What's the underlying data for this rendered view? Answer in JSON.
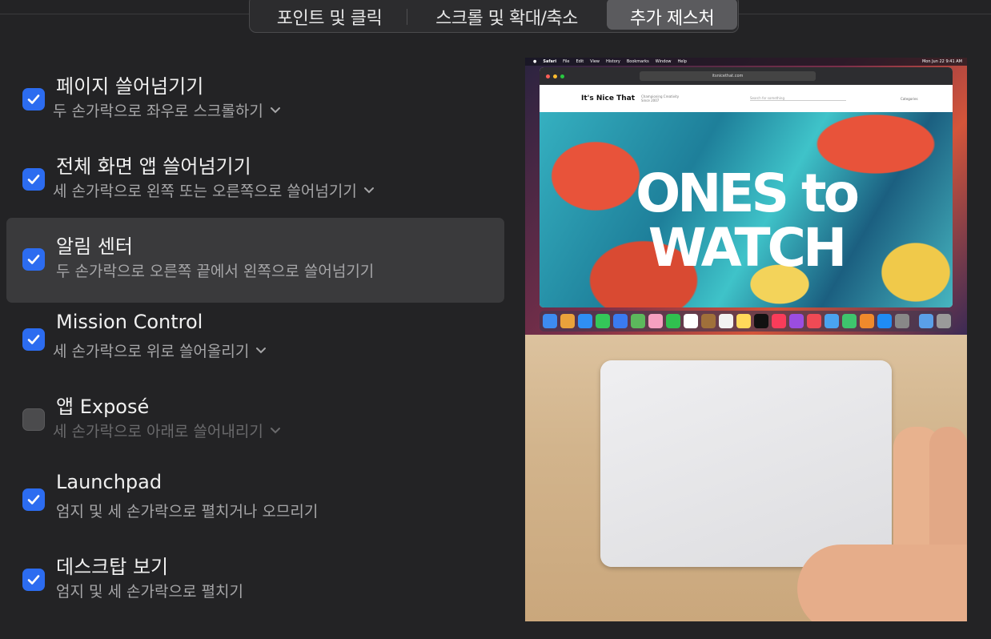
{
  "tabs": [
    {
      "label": "포인트 및 클릭",
      "active": false
    },
    {
      "label": "스크롤 및 확대/축소",
      "active": false
    },
    {
      "label": "추가 제스처",
      "active": true
    }
  ],
  "gestures": [
    {
      "title": "페이지 쓸어넘기기",
      "subtitle": "두 손가락으로 좌우로 스크롤하기",
      "checked": true,
      "has_dropdown": true
    },
    {
      "title": "전체 화면 앱 쓸어넘기기",
      "subtitle": "세 손가락으로 왼쪽 또는 오른쪽으로 쓸어넘기기",
      "checked": true,
      "has_dropdown": true
    },
    {
      "title": "알림 센터",
      "subtitle": "두 손가락으로 오른쪽 끝에서 왼쪽으로 쓸어넘기기",
      "checked": true,
      "has_dropdown": false,
      "selected": true
    },
    {
      "title": "Mission Control",
      "subtitle": "세 손가락으로 위로 쓸어올리기",
      "checked": true,
      "has_dropdown": true
    },
    {
      "title": "앱 Exposé",
      "subtitle": "세 손가락으로 아래로 쓸어내리기",
      "checked": false,
      "has_dropdown": true
    },
    {
      "title": "Launchpad",
      "subtitle": "엄지 및 세 손가락으로 펼치거나 오므리기",
      "checked": true,
      "has_dropdown": false
    },
    {
      "title": "데스크탑 보기",
      "subtitle": "엄지 및 세 손가락으로 펼치기",
      "checked": true,
      "has_dropdown": false
    }
  ],
  "preview": {
    "menubar": {
      "app": "Safari",
      "items": [
        "File",
        "Edit",
        "View",
        "History",
        "Bookmarks",
        "Window",
        "Help"
      ],
      "clock": "Mon Jun 22  9:41 AM"
    },
    "browser": {
      "url": "itsnicethat.com",
      "site_name": "It's Nice That",
      "tagline": "Championing Creativity Since 2007",
      "search_placeholder": "Search for something",
      "categories": "Categories",
      "hero_line1": "ONES to",
      "hero_line2": "WATCH"
    }
  },
  "colors": {
    "accent": "#2c6cf0",
    "background": "#232325",
    "selected_row": "#3a3a3c"
  }
}
